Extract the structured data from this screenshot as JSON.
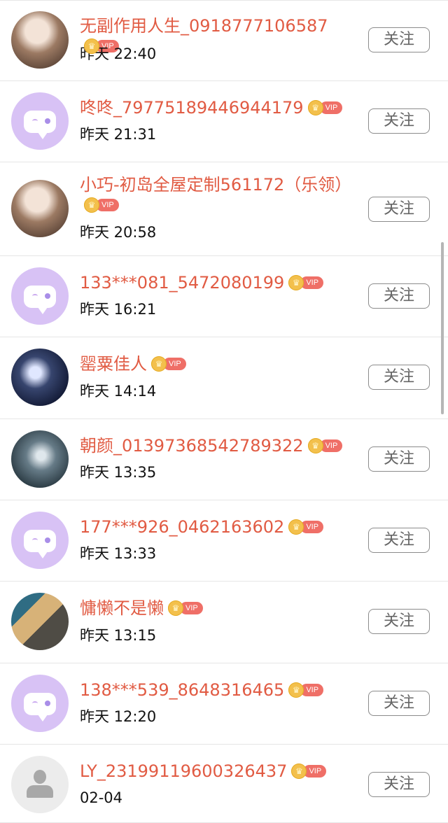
{
  "follow_label": "关注",
  "vip_label": "VIP",
  "users": [
    {
      "name": "无副作用人生_0918777106587",
      "time": "昨天 22:40"
    },
    {
      "name": "咚咚_79775189446944179",
      "time": "昨天 21:31"
    },
    {
      "name": "小巧-初岛全屋定制561172（乐领）",
      "time": "昨天 20:58"
    },
    {
      "name": "133***081_5472080199",
      "time": "昨天 16:21"
    },
    {
      "name": "罂粟佳人",
      "time": "昨天 14:14"
    },
    {
      "name": "朝颜_01397368542789322",
      "time": "昨天 13:35"
    },
    {
      "name": "177***926_0462163602",
      "time": "昨天 13:33"
    },
    {
      "name": "慵懒不是懒",
      "time": "昨天 13:15"
    },
    {
      "name": "138***539_8648316465",
      "time": "昨天 12:20"
    },
    {
      "name": "LY_23199119600326437",
      "time": "02-04"
    }
  ],
  "colors": {
    "name": "#e15b43",
    "time": "#111111",
    "button_border": "#8b8b8b",
    "avatar_purple": "#d8c2f5",
    "vip_pill": "#ef6f67",
    "vip_crown": "#f3c04c"
  }
}
